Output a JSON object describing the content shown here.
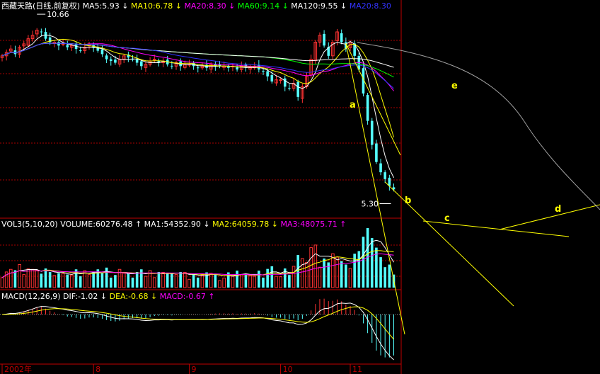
{
  "chart_data": {
    "type": "candlestick",
    "title": "西藏天路(日线,前复权)",
    "ma_header": [
      {
        "text": "MA5:5.93",
        "arrow": "↓",
        "color": "#ffffff"
      },
      {
        "text": "MA10:6.78",
        "arrow": "↓",
        "color": "#ffff00"
      },
      {
        "text": "MA20:8.30",
        "arrow": "↓",
        "color": "#ff00ff"
      },
      {
        "text": "MA60:9.14",
        "arrow": "↓",
        "color": "#00ff00"
      },
      {
        "text": "MA120:9.55",
        "arrow": "↓",
        "color": "#ffffff"
      },
      {
        "text": "MA20:8.30",
        "arrow": "",
        "color": "#3333ff"
      }
    ],
    "high_label": "10.66",
    "low_label": "5.30",
    "price_range": [
      5.0,
      11.0
    ],
    "prices": [
      9.7,
      9.8,
      9.9,
      9.75,
      9.95,
      10.05,
      10.2,
      10.3,
      10.45,
      10.4,
      10.2,
      10.1,
      10.1,
      10.0,
      10.05,
      9.95,
      10.0,
      9.9,
      9.85,
      9.95,
      10.05,
      9.95,
      9.85,
      9.75,
      9.6,
      9.55,
      9.5,
      9.6,
      9.7,
      9.65,
      9.6,
      9.5,
      9.4,
      9.45,
      9.55,
      9.6,
      9.5,
      9.55,
      9.45,
      9.4,
      9.5,
      9.4,
      9.45,
      9.45,
      9.4,
      9.35,
      9.4,
      9.35,
      9.45,
      9.4,
      9.4,
      9.4,
      9.35,
      9.4,
      9.3,
      9.4,
      9.35,
      9.35,
      9.4,
      9.3,
      9.25,
      9.1,
      8.95,
      9.0,
      9.0,
      8.8,
      8.75,
      8.9,
      8.5,
      8.8,
      9.1,
      9.6,
      10.1,
      10.3,
      10.0,
      9.7,
      10.1,
      10.4,
      10.1,
      9.9,
      10.1,
      9.7,
      9.3,
      8.6,
      7.8,
      7.1,
      6.6,
      6.3,
      6.1,
      5.9,
      5.8
    ],
    "volume_header": [
      {
        "text": "VOL3(5,10,20)",
        "arrow": "",
        "color": "#ffffff"
      },
      {
        "text": "VOLUME:60276.48",
        "arrow": "↑",
        "color": "#ffffff"
      },
      {
        "text": "MA1:54352.90",
        "arrow": "↓",
        "color": "#ffffff"
      },
      {
        "text": "MA2:64059.78",
        "arrow": "↓",
        "color": "#ffff00"
      },
      {
        "text": "MA3:48075.71",
        "arrow": "↑",
        "color": "#ff00ff"
      }
    ],
    "macd_header": [
      {
        "text": "MACD(12,26,9)",
        "arrow": "",
        "color": "#ffffff"
      },
      {
        "text": "DIF:-1.02",
        "arrow": "↓",
        "color": "#ffffff"
      },
      {
        "text": "DEA:-0.68",
        "arrow": "↓",
        "color": "#ffff00"
      },
      {
        "text": "MACD:-0.67",
        "arrow": "↑",
        "color": "#ff00ff"
      }
    ],
    "x_labels": [
      {
        "text": "2002年",
        "idx": 0
      },
      {
        "text": "8",
        "idx": 21
      },
      {
        "text": "9",
        "idx": 43
      },
      {
        "text": "10",
        "idx": 64
      },
      {
        "text": "11",
        "idx": 80
      }
    ],
    "annotations": [
      {
        "text": "a"
      },
      {
        "text": "b"
      },
      {
        "text": "c"
      },
      {
        "text": "d"
      },
      {
        "text": "e"
      }
    ],
    "colors": {
      "up": "#ff3232",
      "down": "#54ffff",
      "grid": "#aa0000",
      "axis": "#c00000",
      "annotation": "#ffff00",
      "curve_e": "#a0a0a0"
    }
  }
}
